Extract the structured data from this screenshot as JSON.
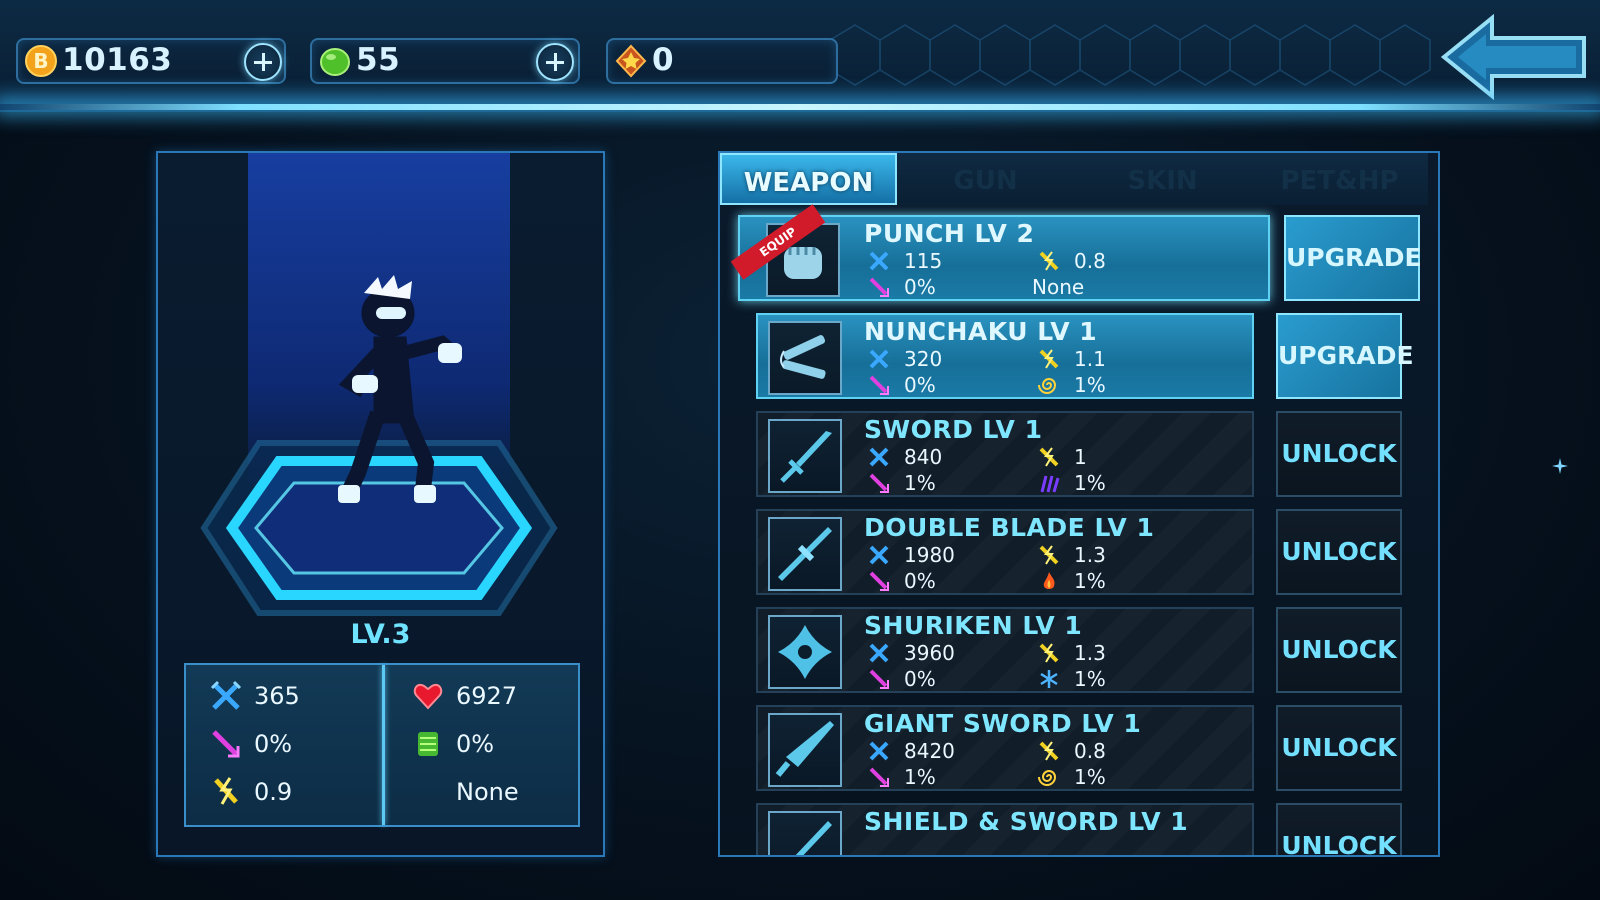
{
  "currency": {
    "coins": "10163",
    "gems": "55",
    "stars": "0"
  },
  "colors": {
    "accent": "#6fe2ff",
    "owned": "#2a92c0",
    "equip_ribbon": "#d21b2a",
    "panel_border": "#2a78b8"
  },
  "character": {
    "level": "LV.3",
    "attack": "365",
    "crit": "0%",
    "speed": "0.9",
    "hp": "6927",
    "defense": "0%",
    "special": "None"
  },
  "tabs": [
    {
      "label": "WEAPON",
      "active": true
    },
    {
      "label": "GUN",
      "active": false
    },
    {
      "label": "SKIN",
      "active": false
    },
    {
      "label": "PET&HP",
      "active": false
    }
  ],
  "weapons": [
    {
      "name": "PUNCH  LV 2",
      "icon": "fist-icon",
      "badge": "EQUIP",
      "atk": "115",
      "spd": "0.8",
      "crit": "0%",
      "effect": "None",
      "effect_icon": "",
      "action": "UPGRADE"
    },
    {
      "name": "NUNCHAKU  LV 1",
      "icon": "nunchaku-icon",
      "atk": "320",
      "spd": "1.1",
      "crit": "0%",
      "effect": "1%",
      "effect_icon": "swirl-icon",
      "action": "UPGRADE"
    },
    {
      "name": "SWORD  LV 1",
      "icon": "sword-icon",
      "atk": "840",
      "spd": "1",
      "crit": "1%",
      "effect": "1%",
      "effect_icon": "claw-icon",
      "action": "UNLOCK"
    },
    {
      "name": "DOUBLE BLADE  LV 1",
      "icon": "double-blade-icon",
      "atk": "1980",
      "spd": "1.3",
      "crit": "0%",
      "effect": "1%",
      "effect_icon": "fire-icon",
      "action": "UNLOCK"
    },
    {
      "name": "SHURIKEN  LV 1",
      "icon": "shuriken-icon",
      "atk": "3960",
      "spd": "1.3",
      "crit": "0%",
      "effect": "1%",
      "effect_icon": "snowflake-icon",
      "action": "UNLOCK"
    },
    {
      "name": "GIANT SWORD  LV 1",
      "icon": "giant-sword-icon",
      "atk": "8420",
      "spd": "0.8",
      "crit": "1%",
      "effect": "1%",
      "effect_icon": "swirl-icon",
      "action": "UNLOCK"
    },
    {
      "name": "SHIELD & SWORD  LV 1",
      "icon": "shield-sword-icon",
      "action": "UNLOCK"
    }
  ]
}
